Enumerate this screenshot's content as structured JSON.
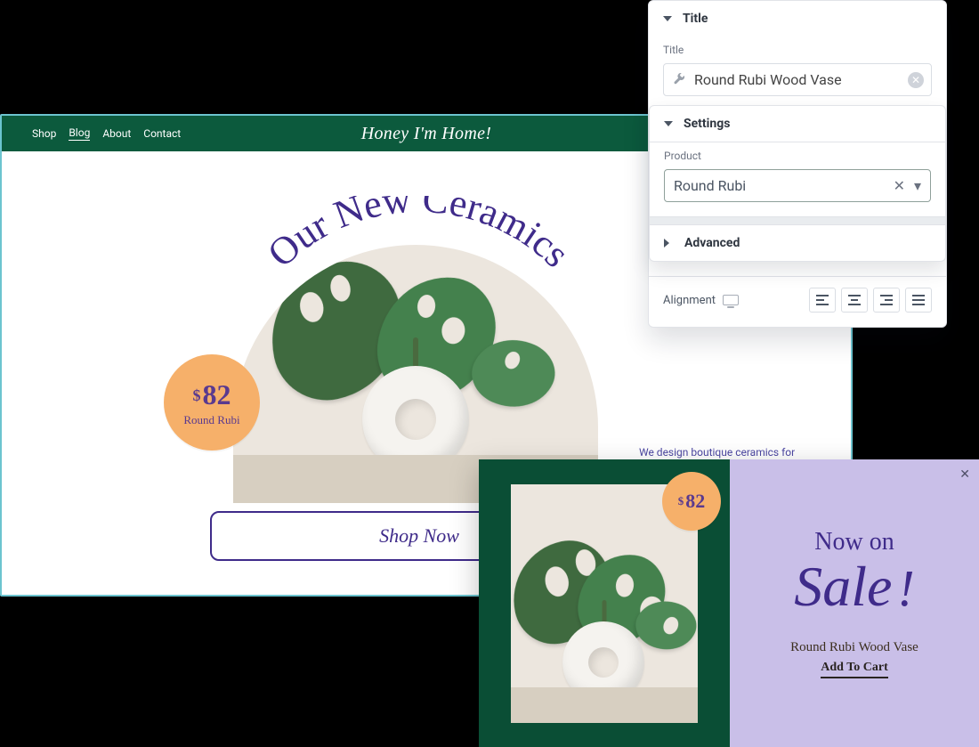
{
  "site": {
    "brand": "Honey I'm Home!",
    "nav": {
      "shop": "Shop",
      "blog": "Blog",
      "about": "About",
      "contact": "Contact"
    },
    "headline": "Our New Ceramics",
    "priceBadge": {
      "currency": "$",
      "amount": "82",
      "name": "Round Rubi"
    },
    "shopNow": "Shop Now",
    "description": "We design boutique ceramics for already a decade to make you home looks pleasant and beautiful"
  },
  "editor": {
    "sections": {
      "title": {
        "heading": "Title",
        "fieldLabel": "Title",
        "value": "Round Rubi Wood Vase"
      },
      "settings": {
        "heading": "Settings",
        "productLabel": "Product",
        "productValue": "Round Rubi"
      },
      "advanced": {
        "heading": "Advanced"
      }
    },
    "alignment": {
      "label": "Alignment"
    }
  },
  "popup": {
    "saleTop": "Now on",
    "saleBottom": "Sale",
    "saleBang": "!",
    "price": {
      "currency": "$",
      "amount": "82"
    },
    "product": "Round Rubi Wood Vase",
    "cta": "Add To Cart"
  }
}
